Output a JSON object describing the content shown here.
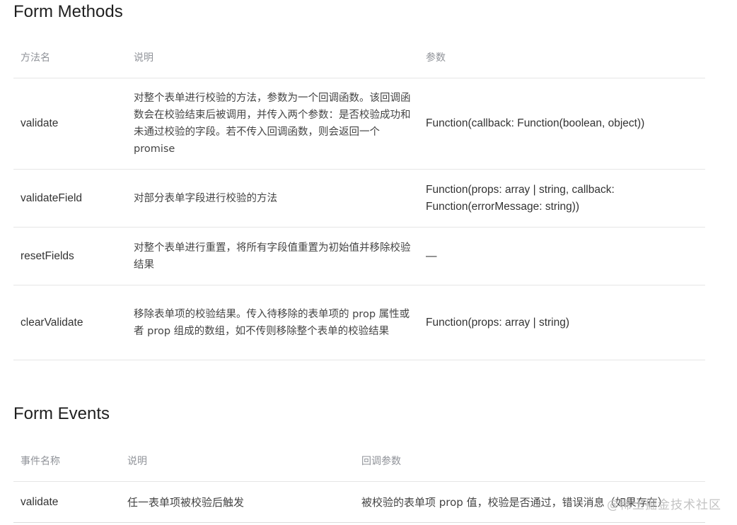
{
  "methods_section": {
    "title": "Form Methods",
    "headers": [
      "方法名",
      "说明",
      "参数"
    ],
    "rows": [
      {
        "name": "validate",
        "description": "对整个表单进行校验的方法，参数为一个回调函数。该回调函数会在校验结束后被调用，并传入两个参数：是否校验成功和未通过校验的字段。若不传入回调函数，则会返回一个 promise",
        "params": "Function(callback: Function(boolean, object))"
      },
      {
        "name": "validateField",
        "description": "对部分表单字段进行校验的方法",
        "params": "Function(props: array | string, callback: Function(errorMessage: string))"
      },
      {
        "name": "resetFields",
        "description": "对整个表单进行重置，将所有字段值重置为初始值并移除校验结果",
        "params": "—"
      },
      {
        "name": "clearValidate",
        "description": "移除表单项的校验结果。传入待移除的表单项的 prop 属性或者 prop 组成的数组，如不传则移除整个表单的校验结果",
        "params": "Function(props: array | string)"
      }
    ]
  },
  "events_section": {
    "title": "Form Events",
    "headers": [
      "事件名称",
      "说明",
      "回调参数"
    ],
    "rows": [
      {
        "name": "validate",
        "description": "任一表单项被校验后触发",
        "callback_params": "被校验的表单项 prop 值，校验是否通过，错误消息（如果存在）"
      }
    ]
  },
  "watermark": "@稀土掘金技术社区"
}
